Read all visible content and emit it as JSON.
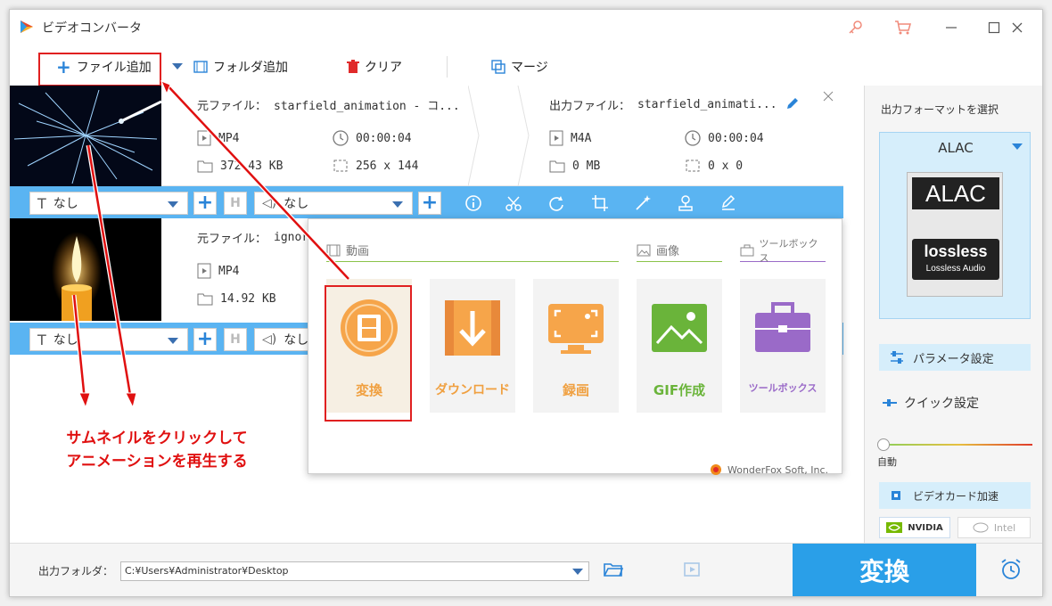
{
  "app": {
    "title": "ビデオコンバータ"
  },
  "toolbar": {
    "add_file": "ファイル追加",
    "add_folder": "フォルダ追加",
    "clear": "クリア",
    "merge": "マージ"
  },
  "files": [
    {
      "source_label": "元ファイル：",
      "source_name": "starfield_animation - コ...",
      "format": "MP4",
      "duration": "00:00:04",
      "size": "372.43 KB",
      "resolution": "256 x 144",
      "output_label": "出力ファイル：",
      "output_name": "starfield_animati...",
      "out_format": "M4A",
      "out_duration": "00:00:04",
      "out_size": "0 MB",
      "out_resolution": "0 x 0",
      "subtitle": "なし",
      "audio": "なし"
    },
    {
      "source_label": "元ファイル：",
      "source_name": "ignor",
      "format": "MP4",
      "size": "14.92 KB",
      "subtitle": "なし",
      "audio": "なし"
    }
  ],
  "popup": {
    "categories": {
      "video": "動画",
      "image": "画像",
      "toolbox": "ツールボックス"
    },
    "tiles": [
      {
        "label": "変換",
        "color": "#f0a040"
      },
      {
        "label": "ダウンロード",
        "color": "#f0a040"
      },
      {
        "label": "録画",
        "color": "#f0a040"
      },
      {
        "label": "GIF作成",
        "color": "#6ab43a"
      },
      {
        "label": "ツールボックス",
        "color": "#9a6ac8"
      }
    ],
    "brand": "WonderFox Soft, Inc."
  },
  "right_panel": {
    "format_title": "出力フォーマットを選択",
    "format_name": "ALAC",
    "badge_top": "ALAC",
    "badge_logo": "lossless",
    "badge_caption": "Lossless Audio",
    "params": "パラメータ設定",
    "quick": "クイック設定",
    "slider_label": "自動",
    "gpu": "ビデオカード加速",
    "nvidia": "NVIDIA",
    "intel": "Intel"
  },
  "bottom": {
    "output_label": "出力フォルダ：",
    "output_path": "C:¥Users¥Administrator¥Desktop",
    "convert": "変換"
  },
  "annotation": {
    "line1": "サムネイルをクリックして",
    "line2": "アニメーションを再生する"
  }
}
